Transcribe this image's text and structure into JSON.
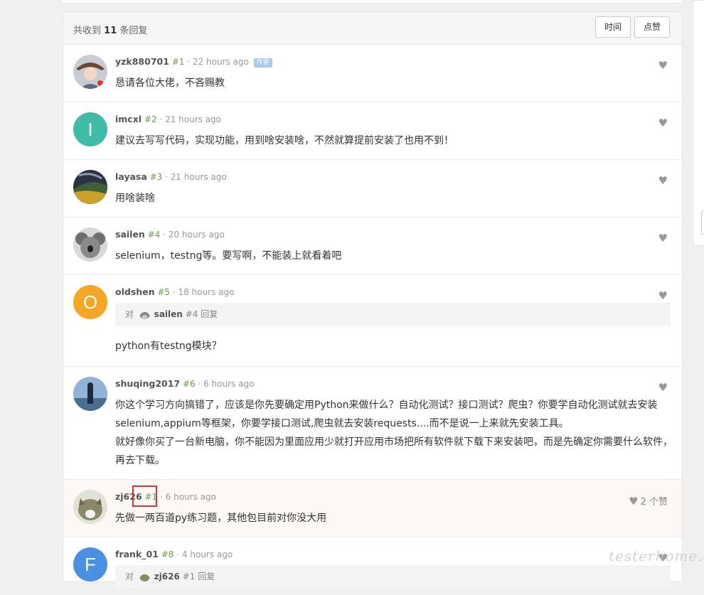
{
  "header": {
    "count_prefix": "共收到",
    "count": "11",
    "count_suffix": "条回复",
    "sort_time": "时间",
    "sort_likes": "点赞"
  },
  "replies": [
    {
      "user": "yzk880701",
      "floor": "#1",
      "time": "· 22 hours ago",
      "badge": "作者",
      "body": "恳请各位大佬，不吝赐教"
    },
    {
      "user": "imcxl",
      "floor": "#2",
      "time": "· 21 hours ago",
      "avatar_letter": "I",
      "avatar_color": "#3fbba6",
      "body": "建议去写写代码，实现功能，用到啥安装啥，不然就算提前安装了也用不到！"
    },
    {
      "user": "layasa",
      "floor": "#3",
      "time": "· 21 hours ago",
      "body": "用啥装啥"
    },
    {
      "user": "sailen",
      "floor": "#4",
      "time": "· 20 hours ago",
      "body": "selenium，testng等。要写啊，不能装上就看着吧"
    },
    {
      "user": "oldshen",
      "floor": "#5",
      "time": "· 18 hours ago",
      "avatar_letter": "O",
      "avatar_color": "#f5a623",
      "quote": {
        "prefix": "对",
        "user": "sailen",
        "floor": "#4",
        "suffix": "回复"
      },
      "body": "python有testng模块？"
    },
    {
      "user": "shuqing2017",
      "floor": "#6",
      "time": "· 6 hours ago",
      "body": "你这个学习方向搞错了，应该是你先要确定用Python来做什么？自动化测试？接口测试？爬虫？你要学自动化测试就去安装selenium,appium等框架，你要学接口测试,爬虫就去安装requests....而不是说一上来就先安装工具。\n就好像你买了一台新电脑，你不能因为里面应用少就打开应用市场把所有软件就下载下来安装吧，而是先确定你需要什么软件，再去下载。"
    },
    {
      "user": "zj626",
      "floor": "#1",
      "time": "· 6 hours ago",
      "likes": "2 个赞",
      "body": "先做一两百道py练习题，其他包目前对你没大用"
    },
    {
      "user": "frank_01",
      "floor": "#8",
      "time": "· 4 hours ago",
      "avatar_letter": "F",
      "avatar_color": "#4a90e2",
      "quote": {
        "prefix": "对",
        "user": "zj626",
        "floor": "#1",
        "suffix": "回复"
      }
    }
  ],
  "icons": {
    "like": "heart-icon"
  },
  "watermark": "testerhome.com"
}
